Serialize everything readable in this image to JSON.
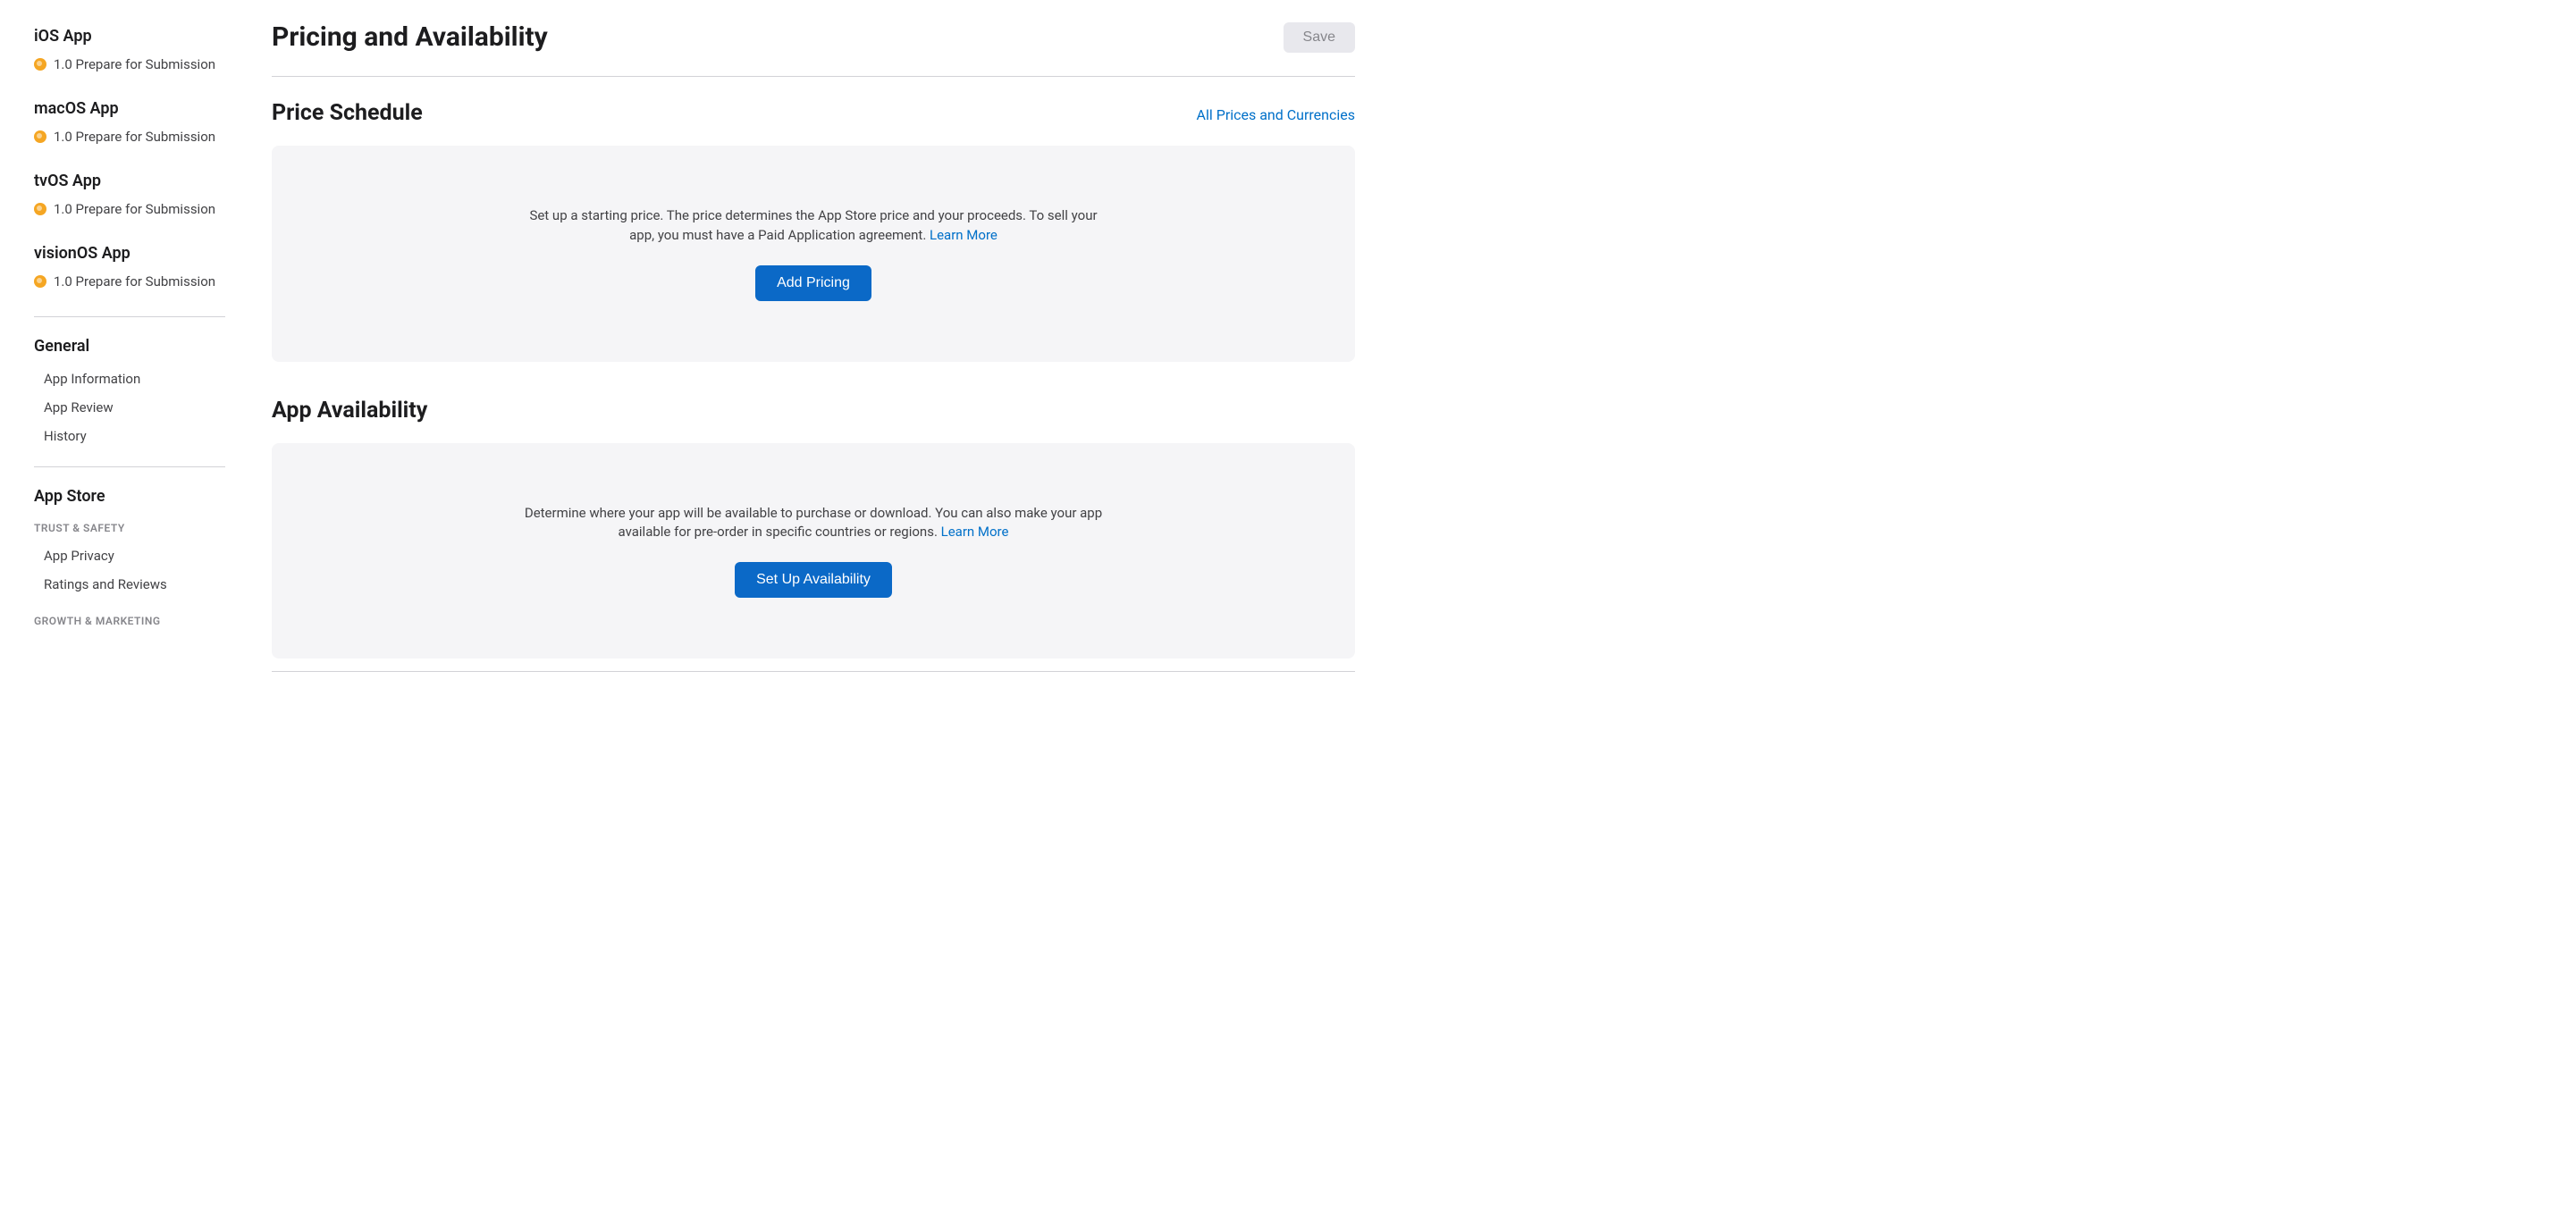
{
  "sidebar": {
    "platforms": [
      {
        "heading": "iOS App",
        "version": "1.0 Prepare for Submission"
      },
      {
        "heading": "macOS App",
        "version": "1.0 Prepare for Submission"
      },
      {
        "heading": "tvOS App",
        "version": "1.0 Prepare for Submission"
      },
      {
        "heading": "visionOS App",
        "version": "1.0 Prepare for Submission"
      }
    ],
    "general": {
      "heading": "General",
      "items": [
        "App Information",
        "App Review",
        "History"
      ]
    },
    "appstore": {
      "heading": "App Store",
      "groups": [
        {
          "label": "TRUST & SAFETY",
          "items": [
            "App Privacy",
            "Ratings and Reviews"
          ]
        },
        {
          "label": "GROWTH & MARKETING",
          "items": []
        }
      ]
    }
  },
  "header": {
    "title": "Pricing and Availability",
    "save_label": "Save"
  },
  "sections": {
    "price": {
      "title": "Price Schedule",
      "link": "All Prices and Currencies",
      "description": "Set up a starting price. The price determines the App Store price and your proceeds. To sell your app, you must have a Paid Application agreement. ",
      "learn_more": "Learn More",
      "button": "Add Pricing"
    },
    "availability": {
      "title": "App Availability",
      "description": "Determine where your app will be available to purchase or download. You can also make your app available for pre-order in specific countries or regions. ",
      "learn_more": "Learn More",
      "button": "Set Up Availability"
    }
  }
}
